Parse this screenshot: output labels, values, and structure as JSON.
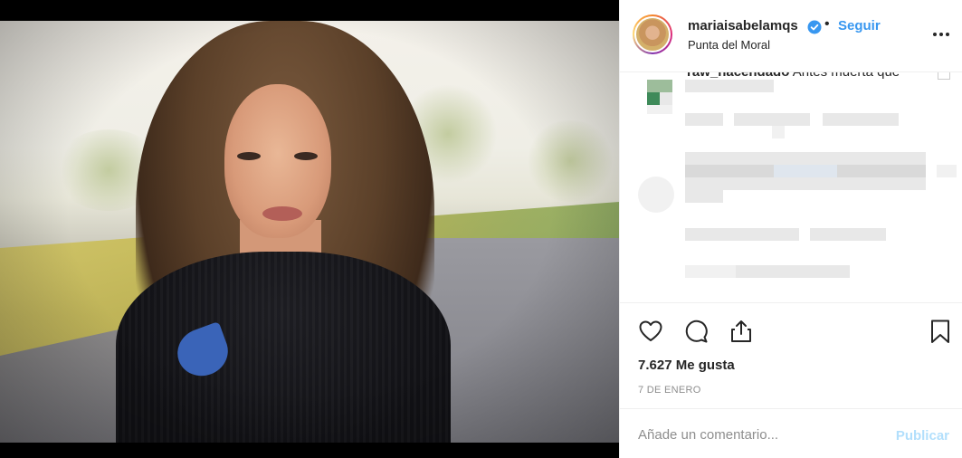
{
  "post": {
    "username": "mariaisabelamqs",
    "separator": "•",
    "follow_label": "Seguir",
    "location": "Punta del Moral",
    "first_comment": {
      "user": "raw_hacendado",
      "text": "Antes muerta que"
    },
    "likes_text": "7.627 Me gusta",
    "date": "7 DE ENERO",
    "comment_placeholder": "Añade un comentario...",
    "publish_label": "Publicar"
  },
  "colors": {
    "link_blue": "#3897f0",
    "publish_disabled": "#b2dffc",
    "verified_blue": "#3897f0",
    "text": "#262626",
    "muted": "#8e8e8e"
  },
  "icons": [
    "verified-badge-icon",
    "more-options-icon",
    "heart-icon",
    "comment-icon",
    "share-icon",
    "bookmark-icon"
  ]
}
